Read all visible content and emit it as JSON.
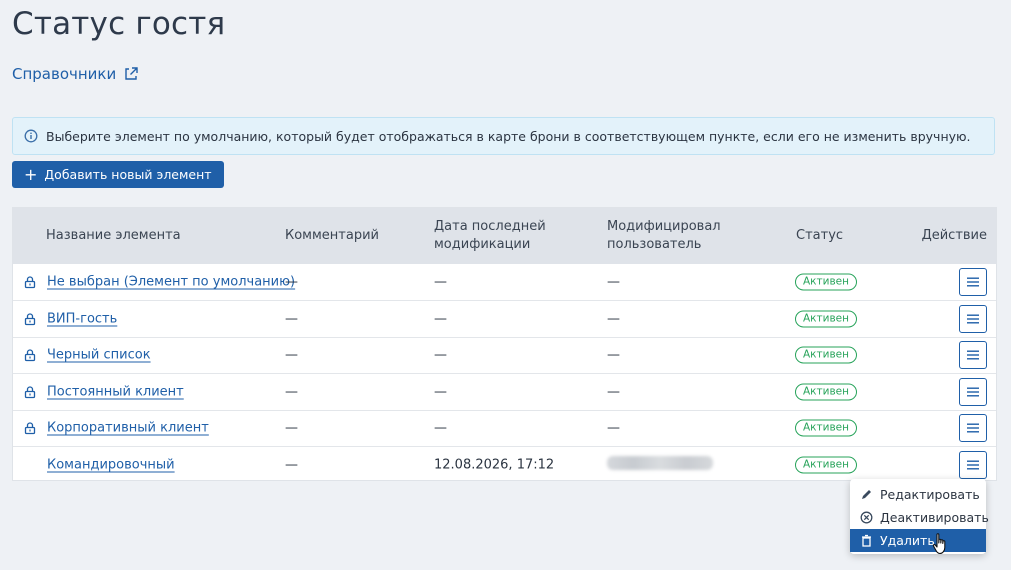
{
  "page": {
    "title": "Статус гостя",
    "breadcrumb": "Справочники"
  },
  "info": {
    "text": "Выберите элемент по умолчанию, который будет отображаться в карте брони в соответствующем пункте, если его не изменить вручную."
  },
  "toolbar": {
    "add_label": "Добавить новый элемент"
  },
  "table": {
    "headers": {
      "name": "Название элемента",
      "comment": "Комментарий",
      "date_line1": "Дата последней",
      "date_line2": "модификации",
      "user_line1": "Модифицировал",
      "user_line2": "пользователь",
      "status": "Статус",
      "action": "Действие"
    },
    "rows": [
      {
        "name": "Не выбран (Элемент по умолчанию)",
        "comment": "—",
        "date": "—",
        "user": "—",
        "status": "Активен",
        "locked": true
      },
      {
        "name": "ВИП-гость",
        "comment": "—",
        "date": "—",
        "user": "—",
        "status": "Активен",
        "locked": true
      },
      {
        "name": "Черный список",
        "comment": "—",
        "date": "—",
        "user": "—",
        "status": "Активен",
        "locked": true
      },
      {
        "name": "Постоянный клиент",
        "comment": "—",
        "date": "—",
        "user": "—",
        "status": "Активен",
        "locked": true
      },
      {
        "name": "Корпоративный клиент",
        "comment": "—",
        "date": "—",
        "user": "—",
        "status": "Активен",
        "locked": true
      },
      {
        "name": "Командировочный",
        "comment": "—",
        "date": "12.08.2026, 17:12",
        "user": "",
        "status": "Активен",
        "locked": false
      }
    ]
  },
  "menu": {
    "items": [
      {
        "label": "Редактировать",
        "icon": "pencil-icon"
      },
      {
        "label": "Деактивировать",
        "icon": "circle-x-icon"
      },
      {
        "label": "Удалить",
        "icon": "trash-icon"
      }
    ]
  },
  "colors": {
    "accent": "#1f5fa8",
    "status_active": "#27a35a",
    "info_bg": "#e3f2fa",
    "header_bg": "#dfe3e9"
  }
}
